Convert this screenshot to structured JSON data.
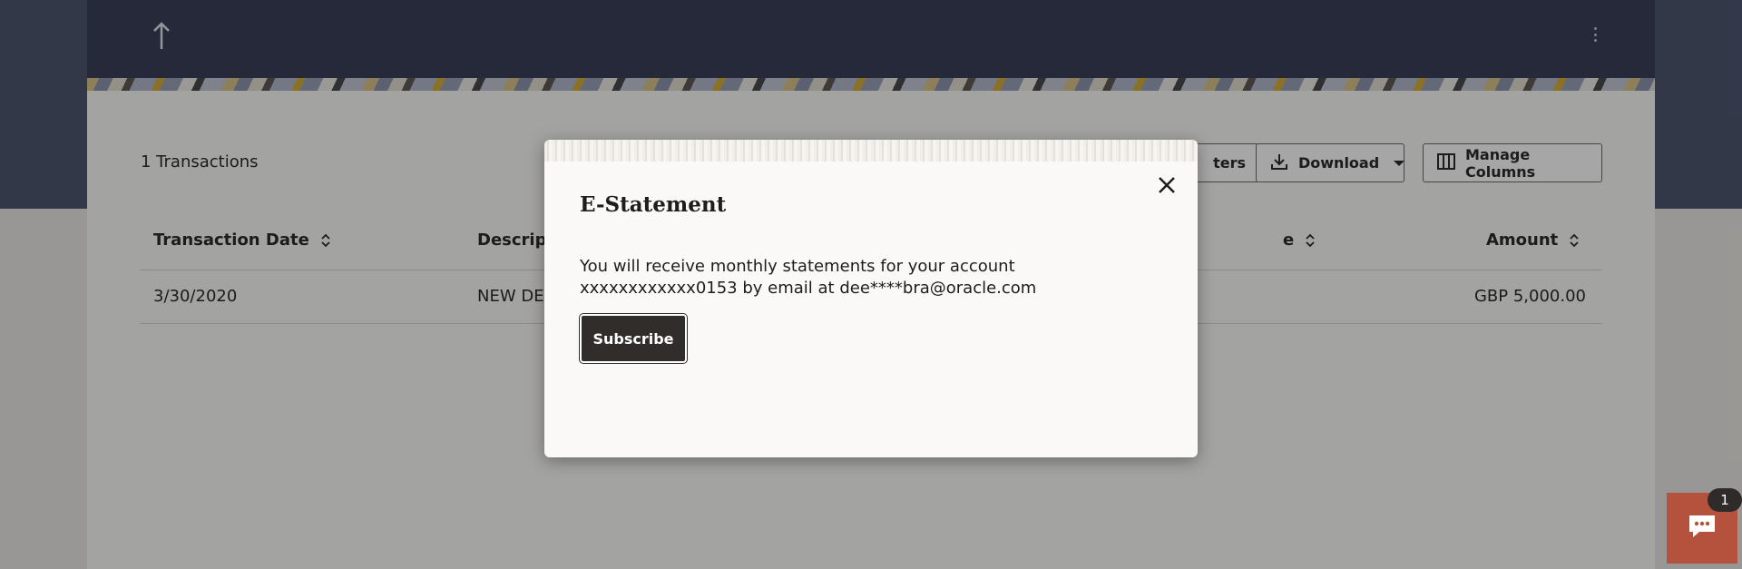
{
  "page": {
    "transactions_count_label": "1 Transactions",
    "toolbar": {
      "filters_label": "ters",
      "download_label": "Download",
      "manage_columns_label": "Manage Columns"
    },
    "table": {
      "columns": {
        "date": "Transaction Date",
        "description": "Descript",
        "type": "e",
        "amount": "Amount"
      },
      "rows": [
        {
          "date": "3/30/2020",
          "description": "NEW DEI",
          "amount": "GBP 5,000.00"
        }
      ]
    }
  },
  "modal": {
    "title": "E-Statement",
    "message_line1": "You will receive monthly statements for your account",
    "message_line2": "xxxxxxxxxxxx0153 by email at dee****bra@oracle.com",
    "subscribe_label": "Subscribe"
  },
  "chat": {
    "badge_count": "1"
  },
  "colors": {
    "header_bg": "#3a3f58",
    "primary_button": "#312d2a",
    "chat_widget": "#b4523e"
  }
}
